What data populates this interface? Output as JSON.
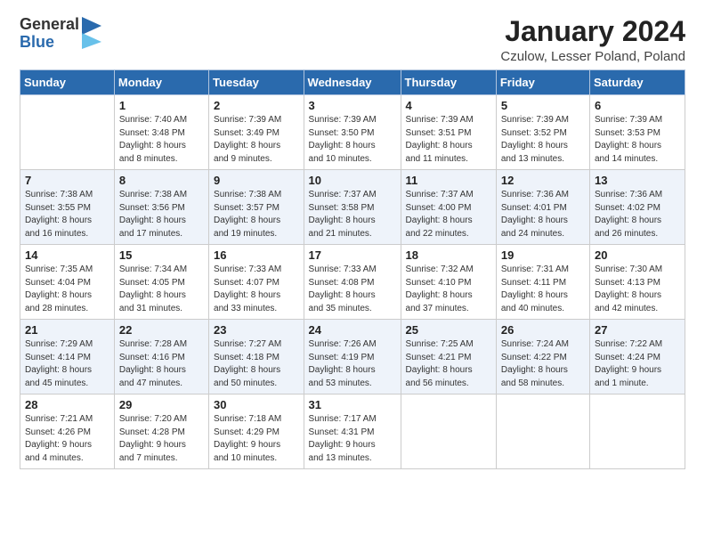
{
  "header": {
    "logo_general": "General",
    "logo_blue": "Blue",
    "title": "January 2024",
    "location": "Czulow, Lesser Poland, Poland"
  },
  "calendar": {
    "days_of_week": [
      "Sunday",
      "Monday",
      "Tuesday",
      "Wednesday",
      "Thursday",
      "Friday",
      "Saturday"
    ],
    "weeks": [
      [
        {
          "day": "",
          "detail": ""
        },
        {
          "day": "1",
          "detail": "Sunrise: 7:40 AM\nSunset: 3:48 PM\nDaylight: 8 hours\nand 8 minutes."
        },
        {
          "day": "2",
          "detail": "Sunrise: 7:39 AM\nSunset: 3:49 PM\nDaylight: 8 hours\nand 9 minutes."
        },
        {
          "day": "3",
          "detail": "Sunrise: 7:39 AM\nSunset: 3:50 PM\nDaylight: 8 hours\nand 10 minutes."
        },
        {
          "day": "4",
          "detail": "Sunrise: 7:39 AM\nSunset: 3:51 PM\nDaylight: 8 hours\nand 11 minutes."
        },
        {
          "day": "5",
          "detail": "Sunrise: 7:39 AM\nSunset: 3:52 PM\nDaylight: 8 hours\nand 13 minutes."
        },
        {
          "day": "6",
          "detail": "Sunrise: 7:39 AM\nSunset: 3:53 PM\nDaylight: 8 hours\nand 14 minutes."
        }
      ],
      [
        {
          "day": "7",
          "detail": "Sunrise: 7:38 AM\nSunset: 3:55 PM\nDaylight: 8 hours\nand 16 minutes."
        },
        {
          "day": "8",
          "detail": "Sunrise: 7:38 AM\nSunset: 3:56 PM\nDaylight: 8 hours\nand 17 minutes."
        },
        {
          "day": "9",
          "detail": "Sunrise: 7:38 AM\nSunset: 3:57 PM\nDaylight: 8 hours\nand 19 minutes."
        },
        {
          "day": "10",
          "detail": "Sunrise: 7:37 AM\nSunset: 3:58 PM\nDaylight: 8 hours\nand 21 minutes."
        },
        {
          "day": "11",
          "detail": "Sunrise: 7:37 AM\nSunset: 4:00 PM\nDaylight: 8 hours\nand 22 minutes."
        },
        {
          "day": "12",
          "detail": "Sunrise: 7:36 AM\nSunset: 4:01 PM\nDaylight: 8 hours\nand 24 minutes."
        },
        {
          "day": "13",
          "detail": "Sunrise: 7:36 AM\nSunset: 4:02 PM\nDaylight: 8 hours\nand 26 minutes."
        }
      ],
      [
        {
          "day": "14",
          "detail": "Sunrise: 7:35 AM\nSunset: 4:04 PM\nDaylight: 8 hours\nand 28 minutes."
        },
        {
          "day": "15",
          "detail": "Sunrise: 7:34 AM\nSunset: 4:05 PM\nDaylight: 8 hours\nand 31 minutes."
        },
        {
          "day": "16",
          "detail": "Sunrise: 7:33 AM\nSunset: 4:07 PM\nDaylight: 8 hours\nand 33 minutes."
        },
        {
          "day": "17",
          "detail": "Sunrise: 7:33 AM\nSunset: 4:08 PM\nDaylight: 8 hours\nand 35 minutes."
        },
        {
          "day": "18",
          "detail": "Sunrise: 7:32 AM\nSunset: 4:10 PM\nDaylight: 8 hours\nand 37 minutes."
        },
        {
          "day": "19",
          "detail": "Sunrise: 7:31 AM\nSunset: 4:11 PM\nDaylight: 8 hours\nand 40 minutes."
        },
        {
          "day": "20",
          "detail": "Sunrise: 7:30 AM\nSunset: 4:13 PM\nDaylight: 8 hours\nand 42 minutes."
        }
      ],
      [
        {
          "day": "21",
          "detail": "Sunrise: 7:29 AM\nSunset: 4:14 PM\nDaylight: 8 hours\nand 45 minutes."
        },
        {
          "day": "22",
          "detail": "Sunrise: 7:28 AM\nSunset: 4:16 PM\nDaylight: 8 hours\nand 47 minutes."
        },
        {
          "day": "23",
          "detail": "Sunrise: 7:27 AM\nSunset: 4:18 PM\nDaylight: 8 hours\nand 50 minutes."
        },
        {
          "day": "24",
          "detail": "Sunrise: 7:26 AM\nSunset: 4:19 PM\nDaylight: 8 hours\nand 53 minutes."
        },
        {
          "day": "25",
          "detail": "Sunrise: 7:25 AM\nSunset: 4:21 PM\nDaylight: 8 hours\nand 56 minutes."
        },
        {
          "day": "26",
          "detail": "Sunrise: 7:24 AM\nSunset: 4:22 PM\nDaylight: 8 hours\nand 58 minutes."
        },
        {
          "day": "27",
          "detail": "Sunrise: 7:22 AM\nSunset: 4:24 PM\nDaylight: 9 hours\nand 1 minute."
        }
      ],
      [
        {
          "day": "28",
          "detail": "Sunrise: 7:21 AM\nSunset: 4:26 PM\nDaylight: 9 hours\nand 4 minutes."
        },
        {
          "day": "29",
          "detail": "Sunrise: 7:20 AM\nSunset: 4:28 PM\nDaylight: 9 hours\nand 7 minutes."
        },
        {
          "day": "30",
          "detail": "Sunrise: 7:18 AM\nSunset: 4:29 PM\nDaylight: 9 hours\nand 10 minutes."
        },
        {
          "day": "31",
          "detail": "Sunrise: 7:17 AM\nSunset: 4:31 PM\nDaylight: 9 hours\nand 13 minutes."
        },
        {
          "day": "",
          "detail": ""
        },
        {
          "day": "",
          "detail": ""
        },
        {
          "day": "",
          "detail": ""
        }
      ]
    ]
  }
}
